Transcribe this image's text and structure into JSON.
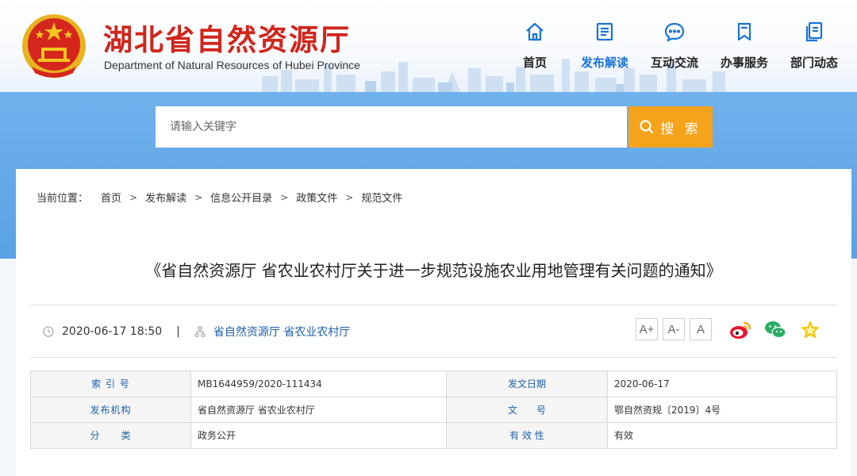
{
  "header": {
    "title": "湖北省自然资源厅",
    "subtitle": "Department of Natural Resources of Hubei Province",
    "emblem_icon": "national-emblem-icon",
    "nav": [
      {
        "label": "首页",
        "icon": "home-icon",
        "active": false
      },
      {
        "label": "发布解读",
        "icon": "document-icon",
        "active": true
      },
      {
        "label": "互动交流",
        "icon": "chat-icon",
        "active": false
      },
      {
        "label": "办事服务",
        "icon": "bookmark-icon",
        "active": false
      },
      {
        "label": "部门动态",
        "icon": "copy-icon",
        "active": false
      }
    ]
  },
  "search": {
    "placeholder": "请输入关键字",
    "button_label": "搜 索"
  },
  "breadcrumb": {
    "lead": "当前位置：",
    "items": [
      "首页",
      "发布解读",
      "信息公开目录",
      "政策文件",
      "规范文件"
    ],
    "separator": ">"
  },
  "article": {
    "title": "《省自然资源厅 省农业农村厅关于进一步规范设施农业用地管理有关问题的通知》",
    "datetime": "2020-06-17 18:50",
    "divider": "|",
    "source": "省自然资源厅 省农业农村厅",
    "font_buttons": [
      "A+",
      "A-",
      "A"
    ],
    "share_icons": [
      "weibo-icon",
      "wechat-icon",
      "favorite-star-icon"
    ]
  },
  "info_table": {
    "rows": [
      {
        "k1": "索 引 号",
        "v1": "MB1644959/2020-111434",
        "k2": "发文日期",
        "v2": "2020-06-17"
      },
      {
        "k1": "发布机构",
        "v1": "省自然资源厅 省农业农村厅",
        "k2": "文　　号",
        "v2": "鄂自然资规〔2019〕4号"
      },
      {
        "k1": "分　　类",
        "v1": "政务公开",
        "k2": "有 效 性",
        "v2": "有效"
      }
    ]
  },
  "colors": {
    "brand_red": "#d0261c",
    "nav_active": "#1a73d9",
    "band_blue": "#5aa2e6",
    "search_orange": "#f5a31a",
    "link_blue": "#1f5fa8"
  }
}
